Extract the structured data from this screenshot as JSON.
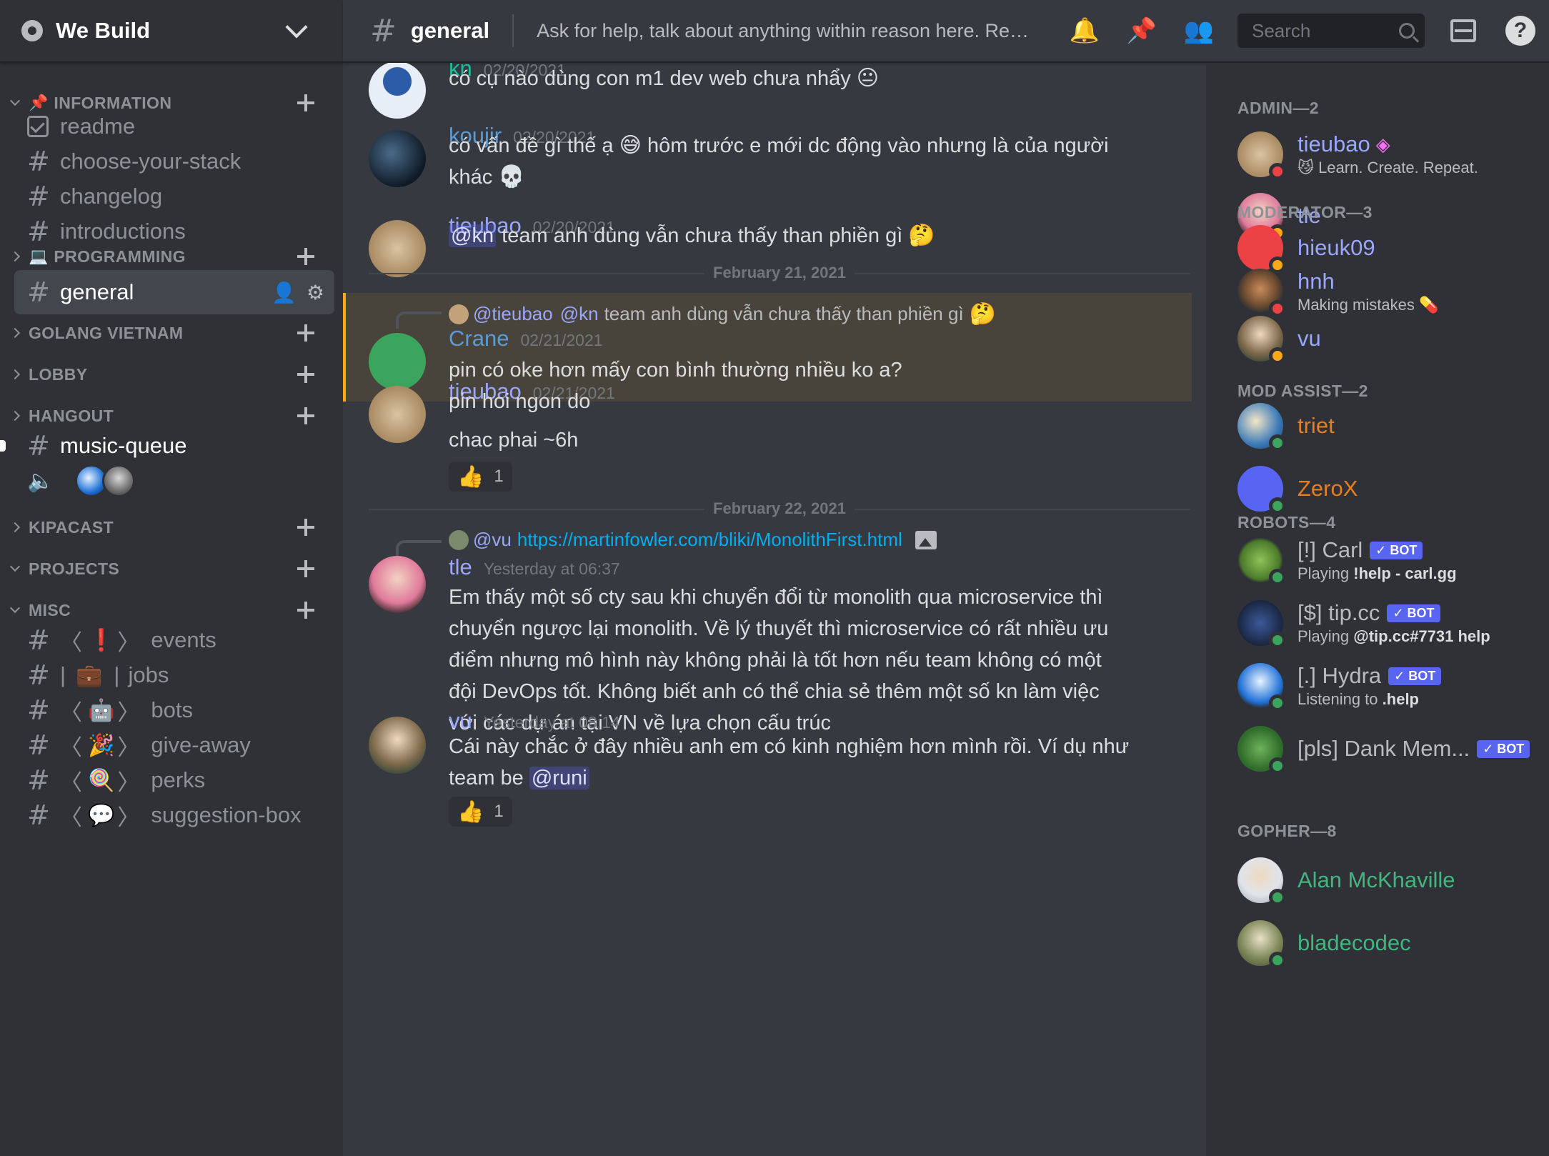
{
  "server": {
    "name": "We Build"
  },
  "sidebar": {
    "categories": {
      "information": "INFORMATION",
      "programming": "PROGRAMMING",
      "golang": "GOLANG VIETNAM",
      "lobby": "LOBBY",
      "hangout": "HANGOUT",
      "kipacast": "KIPACAST",
      "projects": "PROJECTS",
      "misc": "MISC"
    },
    "channels": {
      "readme": "readme",
      "choose": "choose-your-stack",
      "changelog": "changelog",
      "introductions": "introductions",
      "general": "general",
      "music_queue": "music-queue",
      "events": "events",
      "jobs": "jobs",
      "bots": "bots",
      "give_away": "give-away",
      "perks": "perks",
      "suggestion_box": "suggestion-box"
    }
  },
  "header": {
    "channel_name": "general",
    "topic": "Ask for help, talk about anything within reason here. Read the rules before posting.",
    "search_placeholder": "Search"
  },
  "messages": [
    {
      "author": "kn",
      "time": "02/20/2021",
      "text": "có cụ nào dùng con m1 dev web chưa nhẩy",
      "color": "#1abc9c"
    },
    {
      "author": "koujir",
      "time": "02/20/2021",
      "text1": "có vấn đề gì thế ạ",
      "text2": "hôm trước e mới dc động vào nhưng là của người",
      "text3": "khác",
      "color": "#5b9bd5"
    },
    {
      "author": "tieubao",
      "time": "02/20/2021",
      "mention": "@kn",
      "text": "team anh dùng vẫn chưa thấy than phiền gì",
      "color": "#9aa7ff"
    },
    {
      "reply_author": "@tieubao",
      "reply_mention": "@kn",
      "reply_text": "team anh dùng vẫn chưa thấy than phiền gì",
      "author": "Crane",
      "time": "02/21/2021",
      "text": "pin có oke hơn mấy con bình thường nhiều ko a?",
      "color": "#5b9bd5"
    },
    {
      "author": "tieubao",
      "time": "02/21/2021",
      "line1": "pin hoi ngon do",
      "line2": "chac phai ~6h",
      "reaction_count": "1",
      "color": "#9aa7ff"
    },
    {
      "reply_author": "@vu",
      "reply_link": "https://martinfowler.com/bliki/MonolithFirst.html",
      "author": "tle",
      "time": "Yesterday at 06:37",
      "lines": [
        "Em thấy một số cty sau khi chuyển đổi từ monolith qua microservice thì",
        "chuyển ngược lại monolith. Về lý thuyết thì microservice có rất nhiều ưu",
        "điểm nhưng mô hình này không phải là tốt hơn nếu team không có một",
        "đội DevOps tốt. Không biết anh có thể chia sẻ thêm một số kn làm việc",
        "với các dự án tại VN về lựa chọn cấu trúc"
      ],
      "color": "#9aa7ff"
    },
    {
      "author": "vu",
      "time": "Yesterday at 08:14",
      "line1": "Cái này chắc ở đây nhiều anh em có kinh nghiệm hơn mình rồi. Ví dụ như",
      "line2": "team be",
      "mention": "@runi",
      "reaction_count": "1",
      "color": "#9aa7ff"
    }
  ],
  "date_separators": [
    "February 21, 2021",
    "February 22, 2021"
  ],
  "members": {
    "roles": {
      "admin": "ADMIN—2",
      "moderator": "MODERATOR—3",
      "mod_assist": "MOD ASSIST—2",
      "robots": "ROBOTS—4",
      "gopher": "GOPHER—8"
    },
    "list": [
      {
        "name": "tieubao",
        "status": "Learn. Create. Repeat.",
        "color": "#9aa7ff"
      },
      {
        "name": "tle",
        "color": "#9aa7ff"
      },
      {
        "name": "hieuk09",
        "color": "#9aa7ff"
      },
      {
        "name": "hnh",
        "status": "Making mistakes",
        "color": "#9aa7ff"
      },
      {
        "name": "vu",
        "color": "#9aa7ff"
      },
      {
        "name": "triet",
        "color": "#e67e22"
      },
      {
        "name": "ZeroX",
        "color": "#e67e22"
      },
      {
        "name": "[!] Carl",
        "status_prefix": "Playing",
        "status_bold": "!help - carl.gg",
        "bot": "BOT",
        "color": "#b9bbbe"
      },
      {
        "name": "[$] tip.cc",
        "status_prefix": "Playing",
        "status_bold": "@tip.cc#7731 help",
        "bot": "BOT",
        "color": "#b9bbbe"
      },
      {
        "name": "[.] Hydra",
        "status_prefix": "Listening to",
        "status_bold": ".help",
        "bot": "BOT",
        "color": "#b9bbbe"
      },
      {
        "name": "[pls] Dank Mem...",
        "bot": "BOT",
        "color": "#b9bbbe"
      },
      {
        "name": "Alan McKhaville",
        "color": "#43b581"
      },
      {
        "name": "bladecodec",
        "color": "#43b581"
      }
    ]
  }
}
